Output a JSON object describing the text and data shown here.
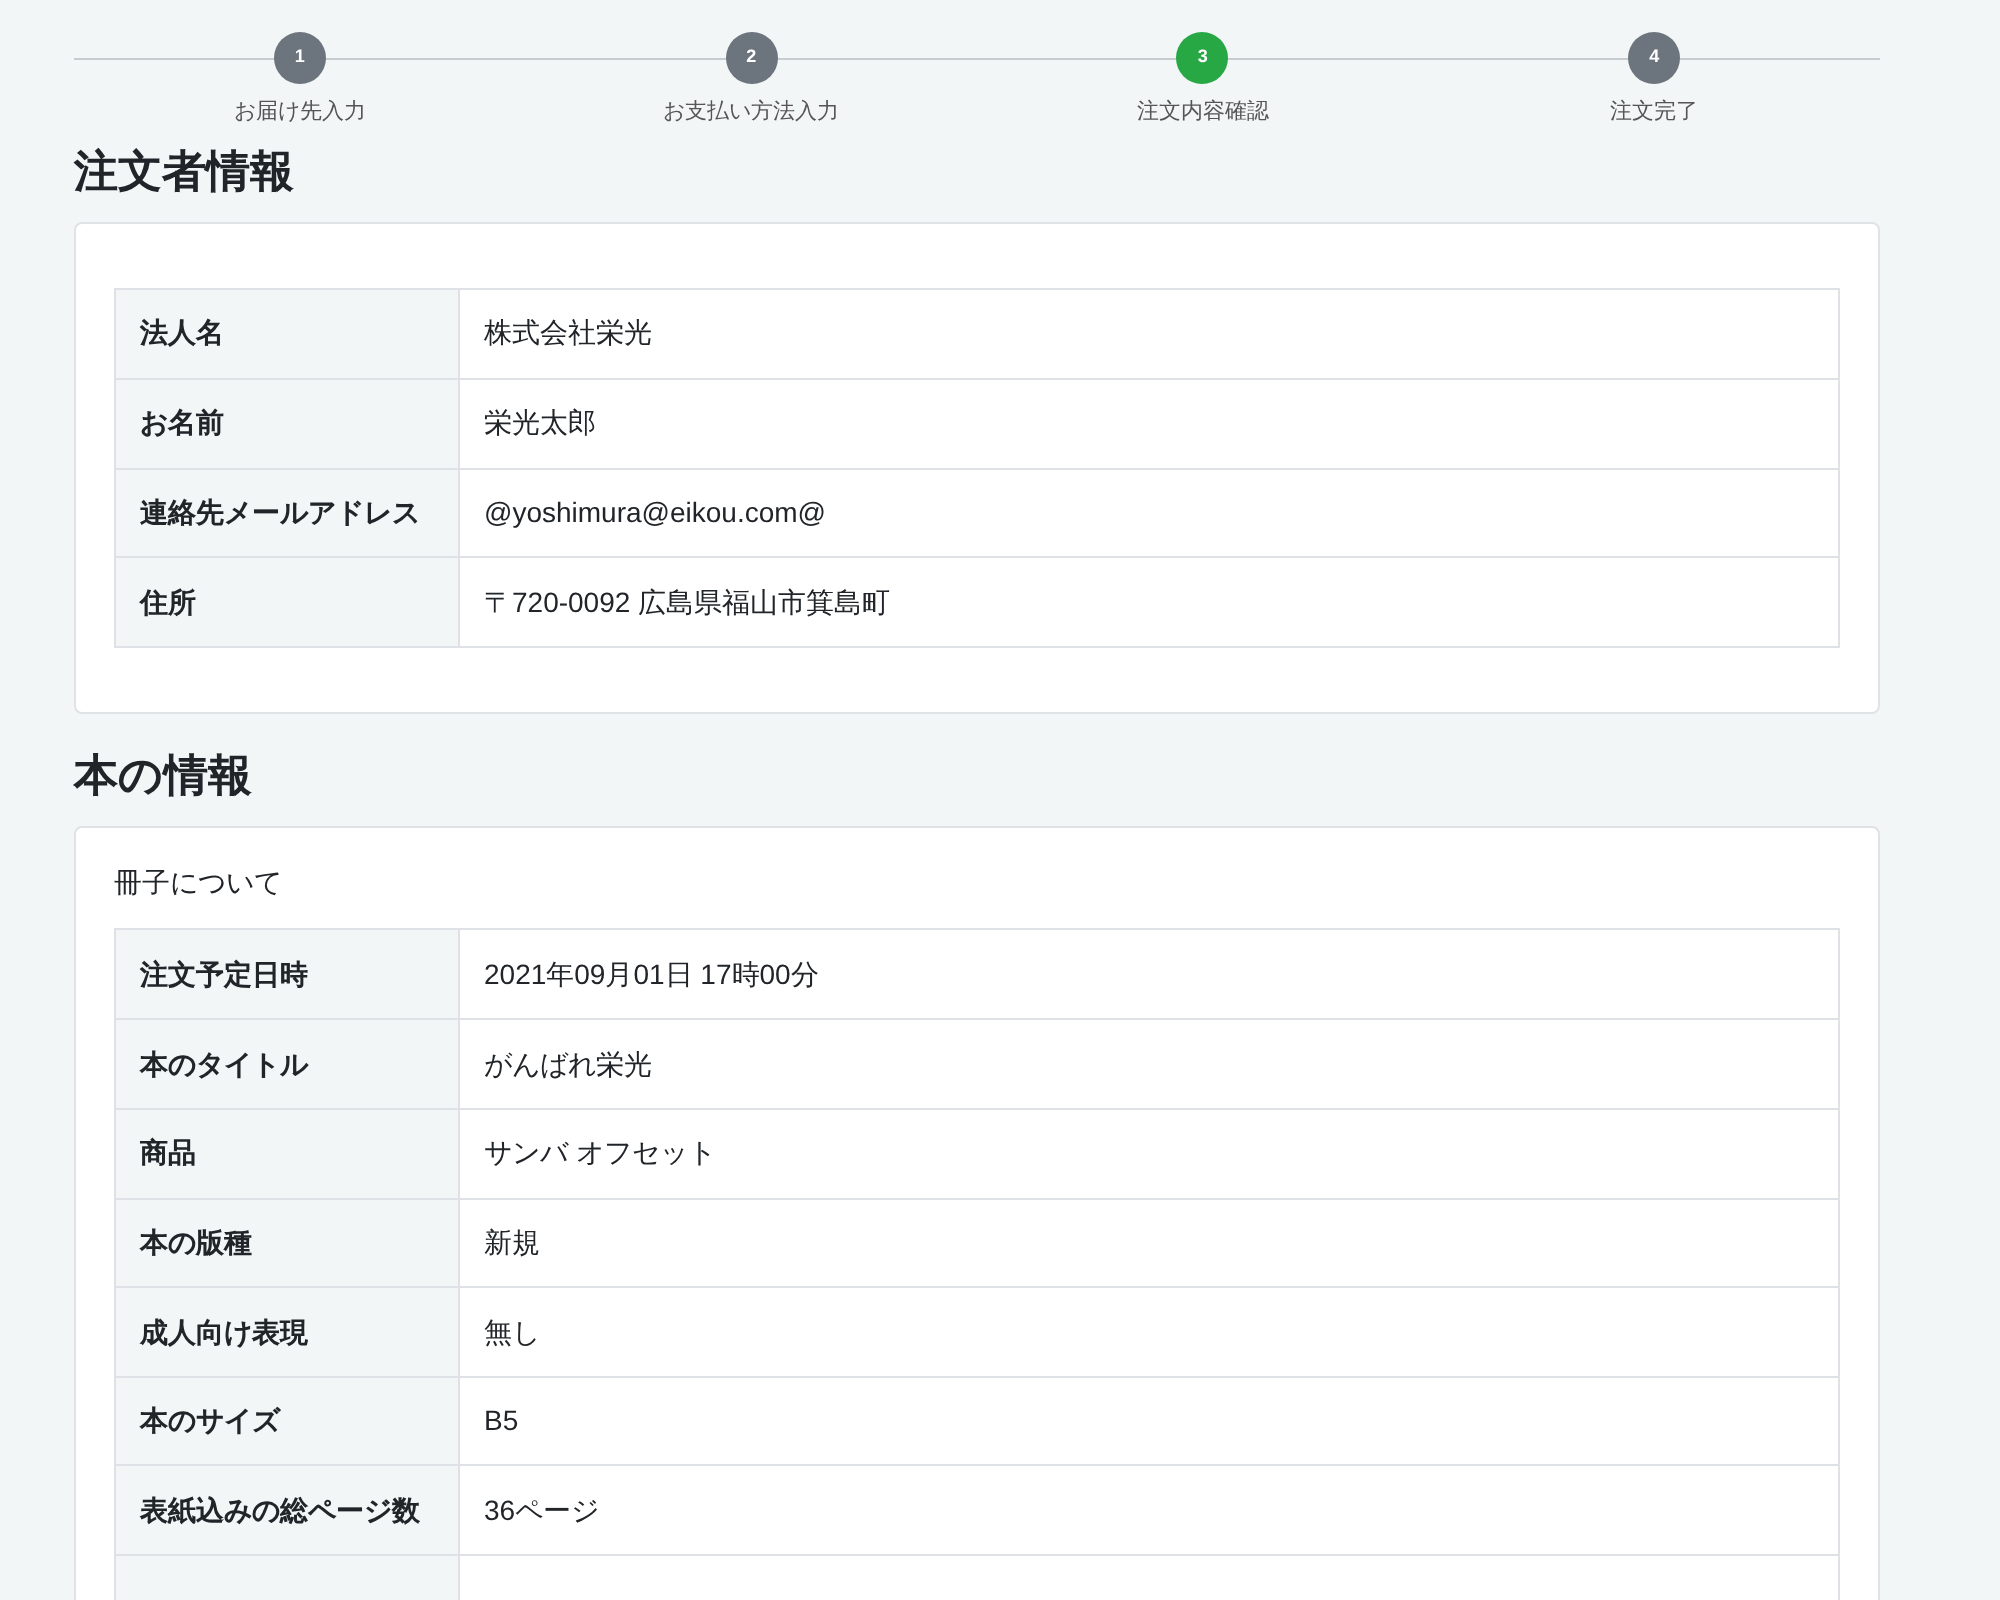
{
  "steps": [
    {
      "number": "1",
      "label": "お届け先入力",
      "selected": false
    },
    {
      "number": "2",
      "label": "お支払い方法入力",
      "selected": false
    },
    {
      "number": "3",
      "label": "注文内容確認",
      "selected": true
    },
    {
      "number": "4",
      "label": "注文完了",
      "selected": false
    }
  ],
  "sections": [
    {
      "title": "注文者情報",
      "rows": [
        {
          "label": "法人名",
          "value": "株式会社栄光"
        },
        {
          "label": "お名前",
          "value": "栄光太郎"
        },
        {
          "label": "連絡先メールアドレス",
          "value": "@yoshimura@eikou.com@"
        },
        {
          "label": "住所",
          "value": "〒720-0092 広島県福山市箕島町"
        }
      ]
    },
    {
      "title": "本の情報",
      "caption": "冊子について",
      "cut_off": true,
      "rows": [
        {
          "label": "注文予定日時",
          "value": "2021年09月01日 17時00分"
        },
        {
          "label": "本のタイトル",
          "value": "がんばれ栄光"
        },
        {
          "label": "商品",
          "value": "サンバ オフセット"
        },
        {
          "label": "本の版種",
          "value": "新規"
        },
        {
          "label": "成人向け表現",
          "value": "無し"
        },
        {
          "label": "本のサイズ",
          "value": "B5"
        },
        {
          "label": "表紙込みの総ページ数",
          "value": "36ページ"
        }
      ]
    }
  ]
}
